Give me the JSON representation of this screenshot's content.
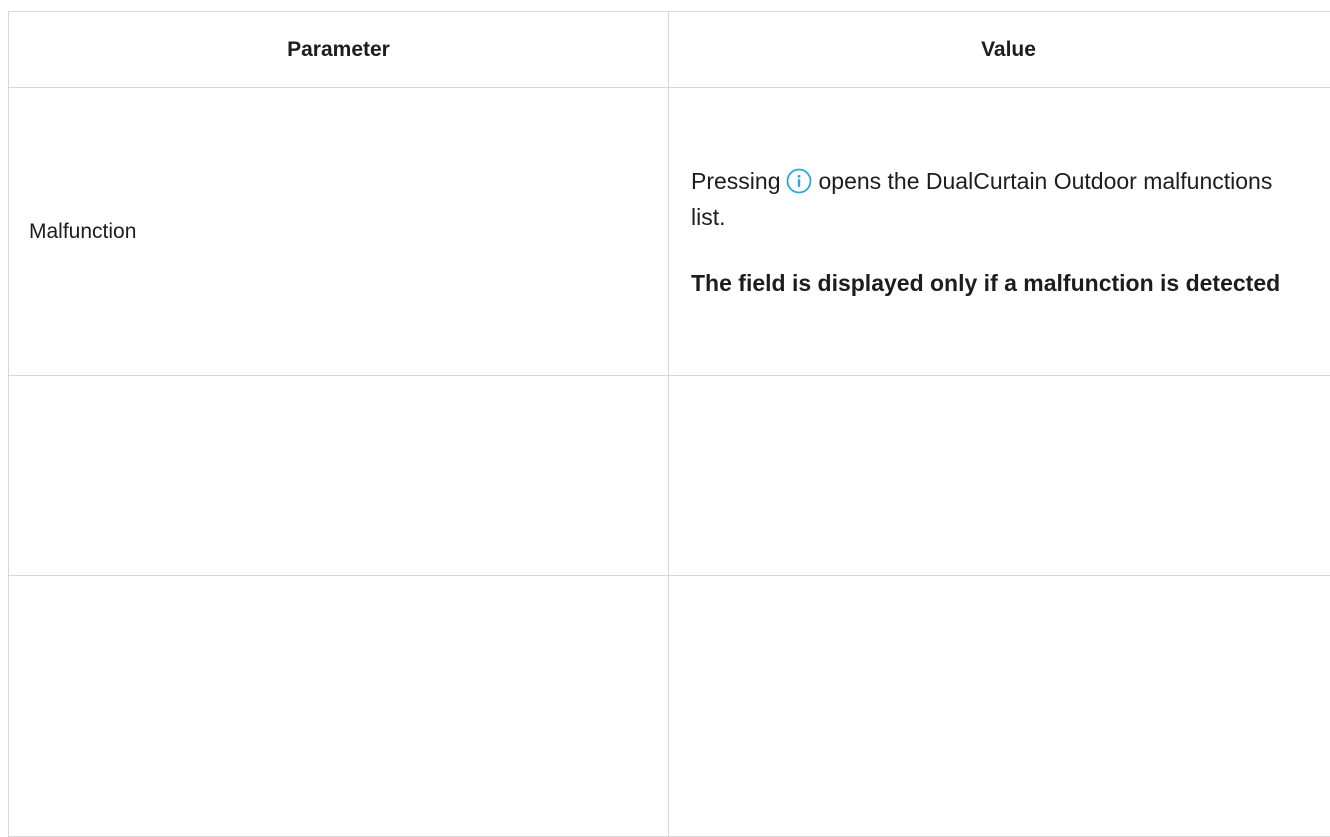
{
  "table": {
    "headers": {
      "parameter": "Parameter",
      "value": "Value"
    },
    "rows": [
      {
        "parameter": "Malfunction",
        "value_before_icon": "Pressing",
        "icon": "info-icon",
        "value_after_icon": "opens the DualCurtain Outdoor malfunctions list.",
        "note": "The field is displayed only if a malfunction is detected"
      },
      {
        "parameter": "",
        "value": ""
      },
      {
        "parameter": "",
        "value": ""
      }
    ]
  },
  "colors": {
    "border": "#d6d6d6",
    "text": "#1d1d1f",
    "info_icon": "#29a8e0"
  }
}
